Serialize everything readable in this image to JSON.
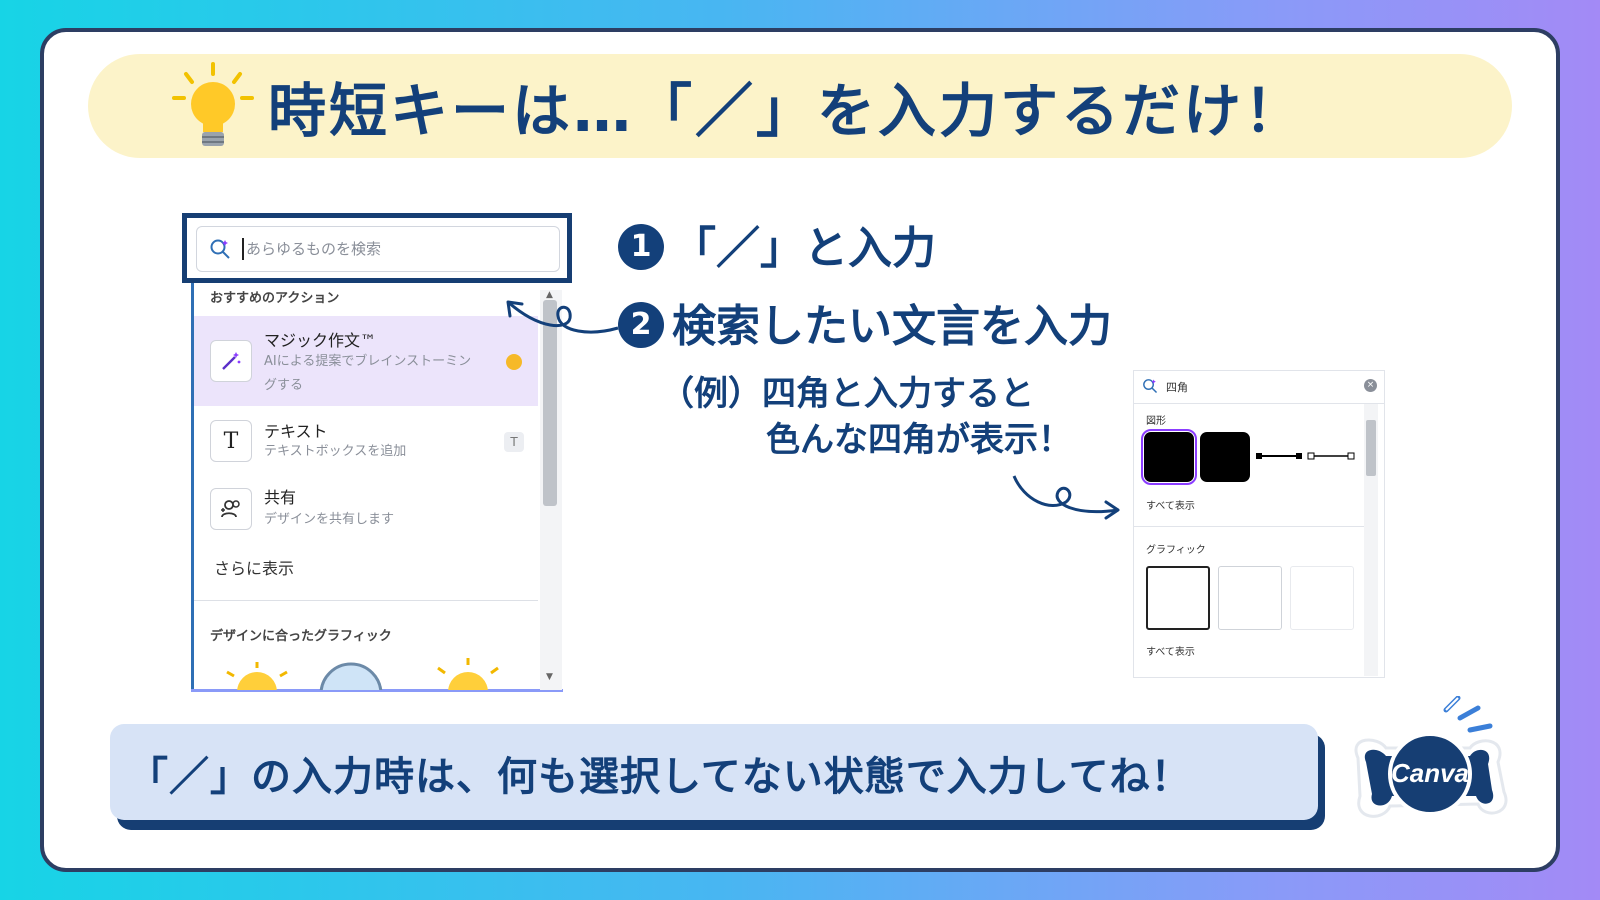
{
  "title": "時短キーは…「／」を入力するだけ！",
  "left_panel": {
    "search_placeholder": "あらゆるものを検索",
    "section_label": "おすすめのアクション",
    "items": [
      {
        "title": "マジック作文™",
        "desc1": "AIによる提案でブレインストーミン",
        "desc2": "グする"
      },
      {
        "title": "テキスト",
        "desc": "テキストボックスを追加",
        "shortcut": "T"
      },
      {
        "title": "共有",
        "desc": "デザインを共有します"
      }
    ],
    "more_label": "さらに表示",
    "graphics_label": "デザインに合ったグラフィック"
  },
  "steps": [
    {
      "num": "1",
      "text": "「／」と入力"
    },
    {
      "num": "2",
      "text": "検索したい文言を入力"
    }
  ],
  "example": {
    "line1": "（例）四角と入力すると",
    "line2": "色んな四角が表示！"
  },
  "right_panel": {
    "search_value": "四角",
    "shapes_label": "図形",
    "see_all_1": "すべて表示",
    "graphics_label": "グラフィック",
    "see_all_2": "すべて表示"
  },
  "bottom_note": "「／」の入力時は、何も選択してない状態で入力してね！",
  "logo_text": "Canva",
  "colors": {
    "navy": "#13407a",
    "accent_purple": "#ece4fb",
    "title_bg": "#fcf3c9",
    "note_bg": "#d7e3f6"
  }
}
